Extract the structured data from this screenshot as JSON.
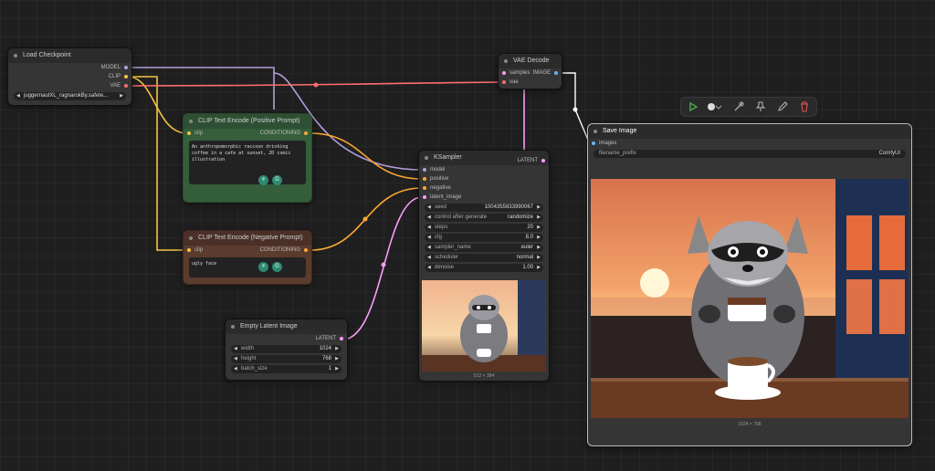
{
  "colors": {
    "model": "#b39ddb",
    "clip": "#f5c542",
    "vae": "#ff6e6e",
    "conditioning": "#ffa931",
    "latent": "#ff9cf9",
    "image": "#64b5f6",
    "positive_node": "#355e3b",
    "negative_node": "#5a3b2e"
  },
  "load_checkpoint": {
    "title": "Load Checkpoint",
    "outputs": [
      "MODEL",
      "CLIP",
      "VAE"
    ],
    "ckpt_name": "juggernautXL_ragnarokBy.safete..."
  },
  "clip_positive": {
    "title": "CLIP Text Encode (Positive Prompt)",
    "input": "clip",
    "output": "CONDITIONING",
    "text": "An anthropomorphic raccoon drinking coffee in a cafe at sunset, 2D comic illustration"
  },
  "clip_negative": {
    "title": "CLIP Text Encode (Negative Prompt)",
    "input": "clip",
    "output": "CONDITIONING",
    "text": "ugly face"
  },
  "empty_latent": {
    "title": "Empty Latent Image",
    "output": "LATENT",
    "widgets": [
      {
        "label": "width",
        "value": "1024"
      },
      {
        "label": "height",
        "value": "768"
      },
      {
        "label": "batch_size",
        "value": "1"
      }
    ]
  },
  "ksampler": {
    "title": "KSampler",
    "inputs": [
      "model",
      "positive",
      "negative",
      "latent_image"
    ],
    "output": "LATENT",
    "widgets": [
      {
        "label": "seed",
        "value": "1004355833990067"
      },
      {
        "label": "control after generate",
        "value": "randomize"
      },
      {
        "label": "steps",
        "value": "20"
      },
      {
        "label": "cfg",
        "value": "8.0"
      },
      {
        "label": "sampler_name",
        "value": "euler"
      },
      {
        "label": "scheduler",
        "value": "normal"
      },
      {
        "label": "denoise",
        "value": "1.00"
      }
    ],
    "preview_size": "512 × 384"
  },
  "vae_decode": {
    "title": "VAE Decode",
    "inputs": [
      "samples",
      "vae"
    ],
    "output": "IMAGE"
  },
  "save_image": {
    "title": "Save Image",
    "input": "images",
    "prefix_label": "filename_prefix",
    "prefix_value": "ComfyUI",
    "image_size": "1024 × 768"
  },
  "toolbar": {
    "icons": [
      "play-icon",
      "color-dot-icon",
      "chevron-down-icon",
      "bypass-icon",
      "pin-icon",
      "edit-icon",
      "trash-icon"
    ]
  }
}
